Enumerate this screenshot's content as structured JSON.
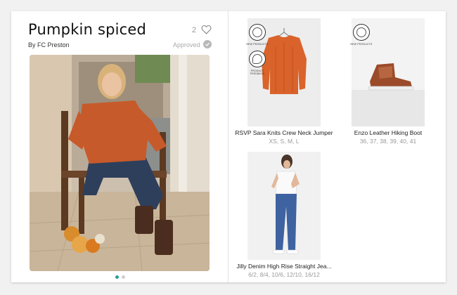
{
  "look": {
    "title": "Pumpkin spiced",
    "like_count": "2",
    "author": "By FC Preston",
    "status": "Approved",
    "icons": {
      "like": "heart-outline-icon",
      "approved": "check-circle-icon"
    },
    "photo": "woman-orange-sweater-chair-photo",
    "carousel_pages": 2,
    "carousel_active": 1
  },
  "products": [
    {
      "name": "RSVP Sara Knits Crew Neck Jumper",
      "sizes": "XS, S, M, L",
      "image": "orange-jumper-on-hanger",
      "badges": [
        "NEW PRODUCTS",
        "PRODUCT FEEDBACK"
      ]
    },
    {
      "name": "Enzo Leather Hiking Boot",
      "sizes": "36, 37, 38, 39, 40, 41",
      "image": "tan-hiking-boot",
      "badges": [
        "NEW PRODUCTS"
      ]
    },
    {
      "name": "Jilly Denim High Rise Straight Jea...",
      "sizes": "6/2, 8/4, 10/6, 12/10, 16/12",
      "image": "woman-white-tee-jeans",
      "badges": []
    }
  ],
  "colors": {
    "accent": "#2aa198",
    "inactive_dot": "#cfcfcf",
    "muted_text": "#999999"
  }
}
